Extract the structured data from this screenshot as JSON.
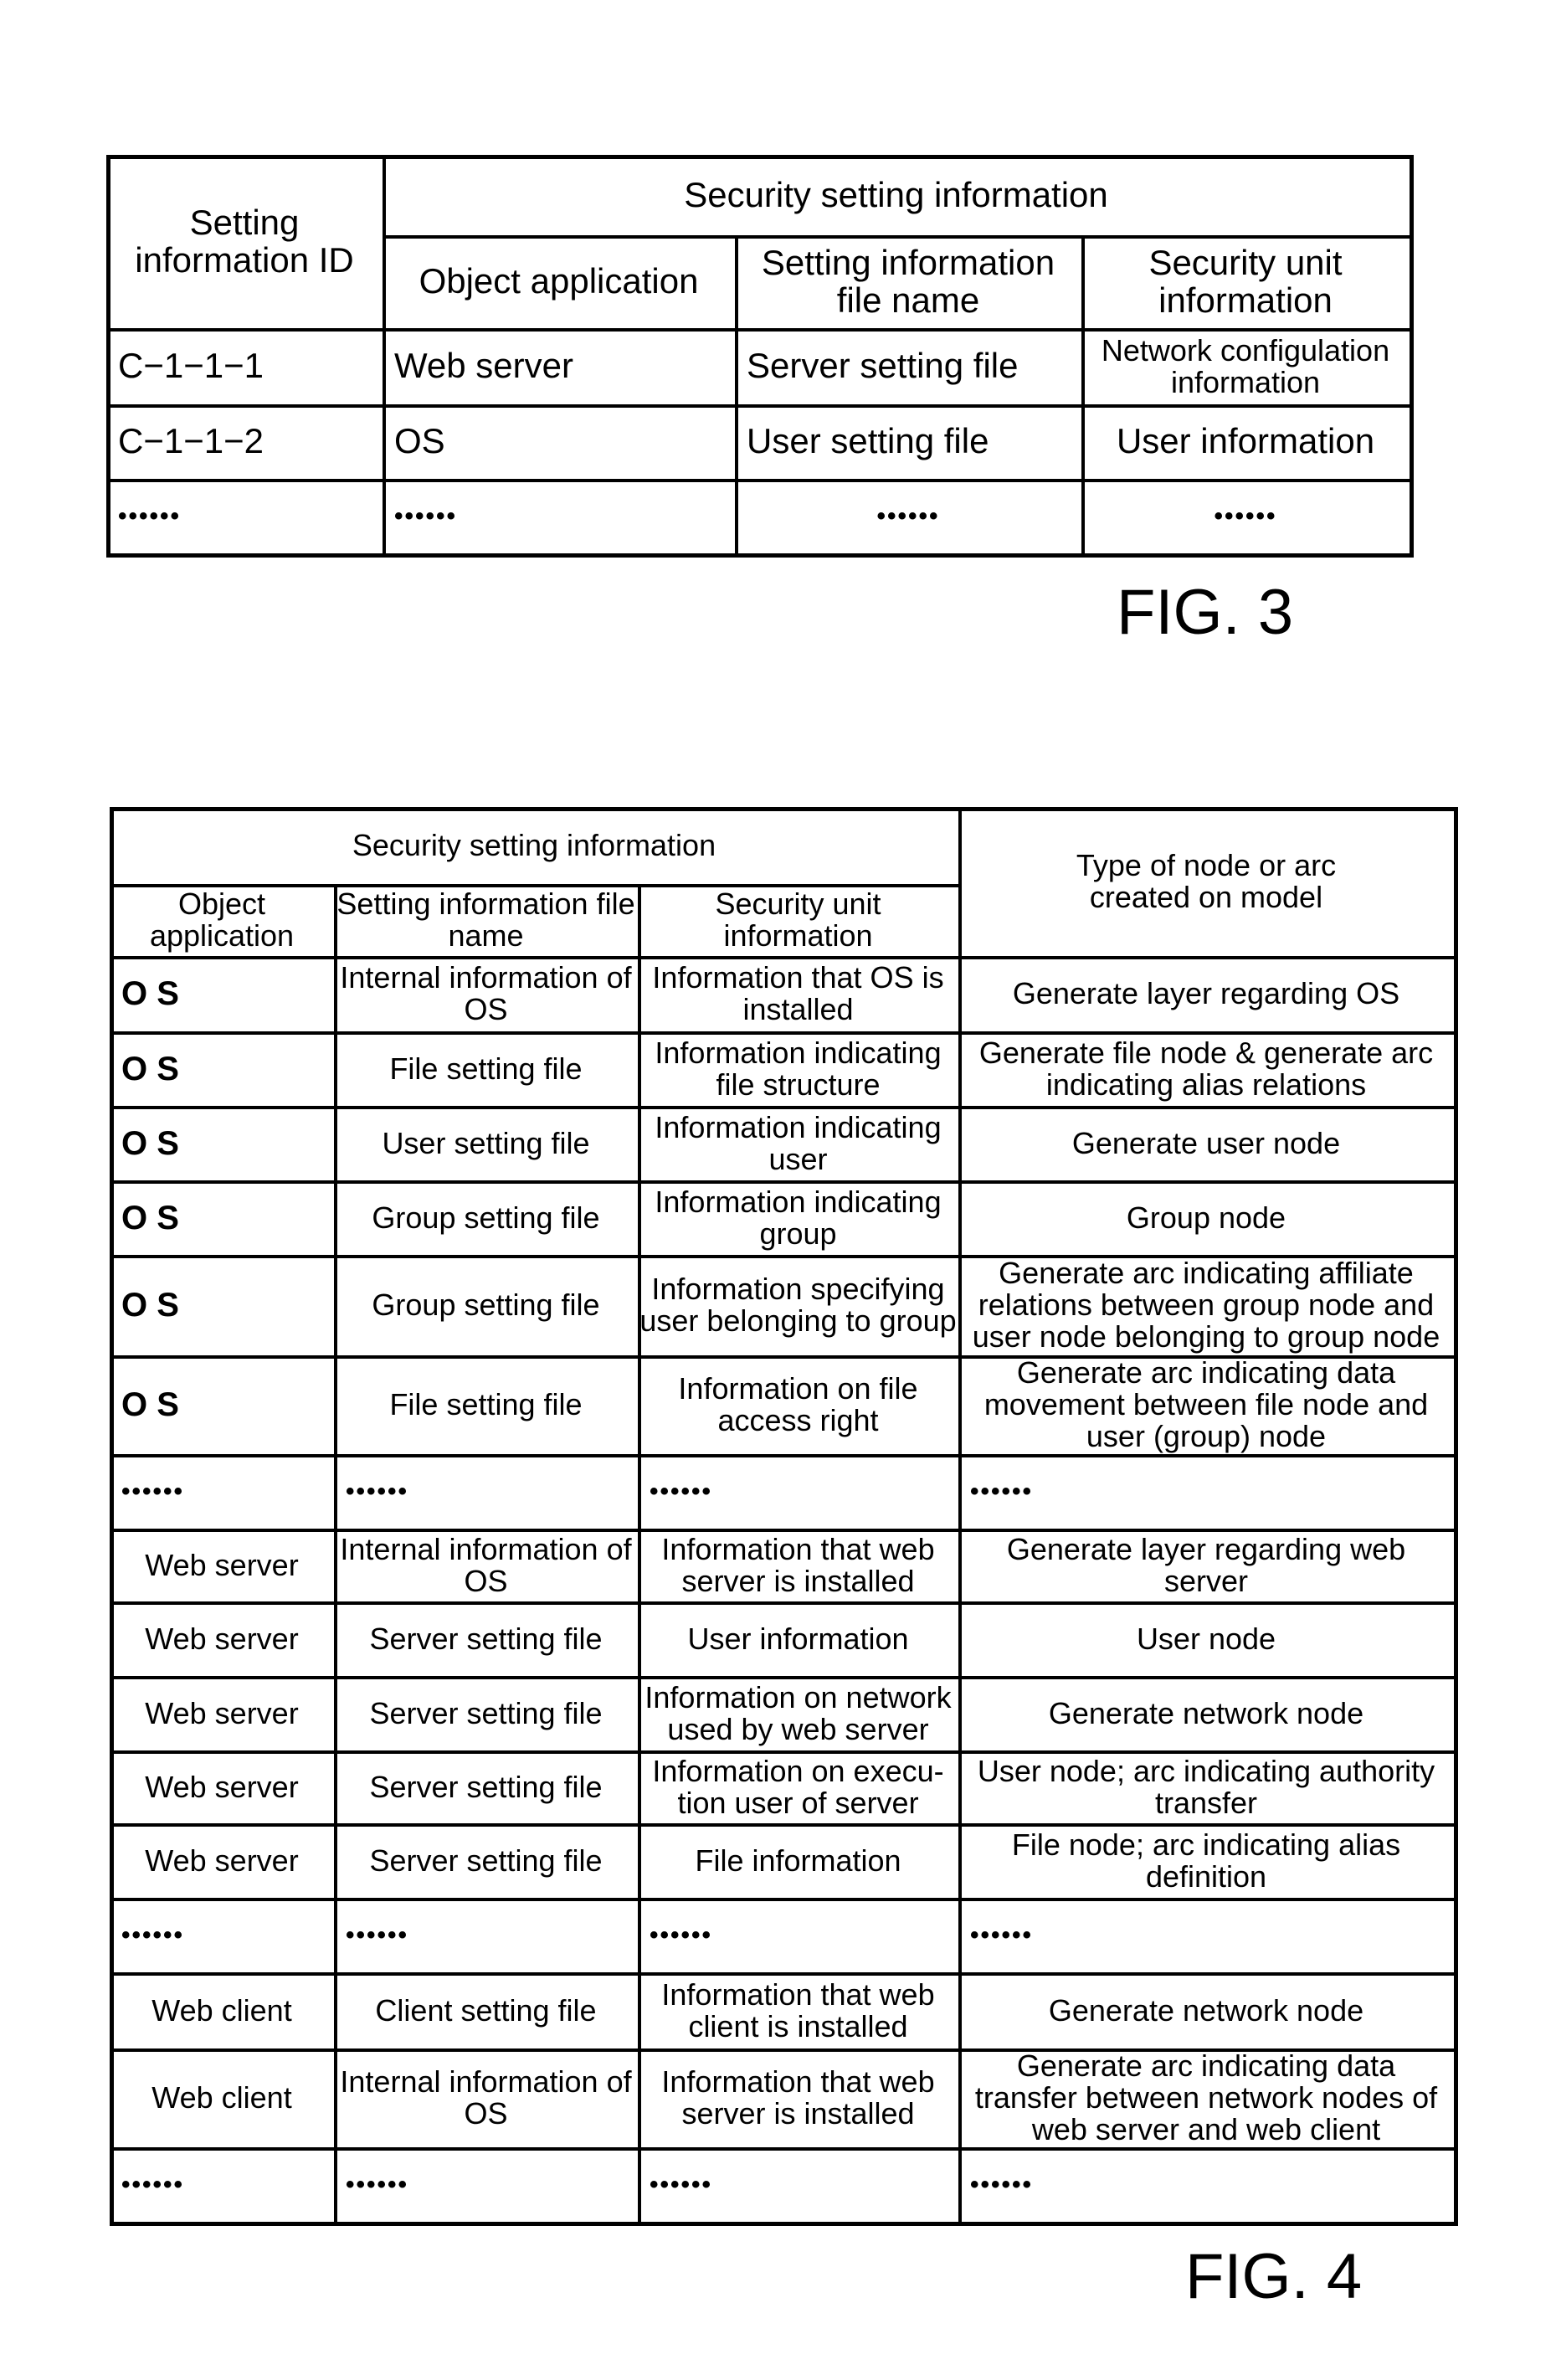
{
  "fig3": {
    "label": "FIG. 3",
    "headers": {
      "id": "Setting information ID",
      "group": "Security setting information",
      "object_application": "Object application",
      "file_name": "Setting information file name",
      "security_unit": "Security unit information"
    },
    "rows": [
      {
        "id": "C−1−1−1",
        "app": "Web server",
        "file": "Server setting file",
        "unit": "Network configulation information"
      },
      {
        "id": "C−1−1−2",
        "app": "OS",
        "file": "User setting file",
        "unit": "User information"
      },
      {
        "id": "••••••",
        "app": "••••••",
        "file": "••••••",
        "unit": "••••••"
      }
    ]
  },
  "fig4": {
    "label": "FIG. 4",
    "headers": {
      "group": "Security setting information",
      "type": "Type of node or arc created on model",
      "object_application": "Object application",
      "file_name": "Setting information file name",
      "security_unit": "Security unit information"
    },
    "rows": [
      {
        "app": "O S",
        "file": "Internal information of OS",
        "unit": "Information that OS is installed",
        "type": "Generate layer regarding OS"
      },
      {
        "app": "O S",
        "file": "File setting file",
        "unit": "Information indicating file structure",
        "type": "Generate file node & generate arc indicating alias relations"
      },
      {
        "app": "O S",
        "file": "User setting file",
        "unit": "Information indicating user",
        "type": "Generate user node"
      },
      {
        "app": "O S",
        "file": "Group setting file",
        "unit": "Information indicating group",
        "type": "Group node"
      },
      {
        "app": "O S",
        "file": "Group setting file",
        "unit": "Information specifying user belonging to group",
        "type": "Generate arc indicating affiliate relations between group node and user node belonging to group node"
      },
      {
        "app": "O S",
        "file": "File setting file",
        "unit": "Information on file access right",
        "type": "Generate arc indicating data movement between file node and user (group) node"
      },
      {
        "app": "••••••",
        "file": "••••••",
        "unit": "••••••",
        "type": "••••••"
      },
      {
        "app": "Web server",
        "file": "Internal information of OS",
        "unit": "Information that web server is installed",
        "type": "Generate layer regarding web server"
      },
      {
        "app": "Web server",
        "file": "Server setting file",
        "unit": "User information",
        "type": "User node"
      },
      {
        "app": "Web server",
        "file": "Server setting file",
        "unit": "Information on network used by web server",
        "type": "Generate network node"
      },
      {
        "app": "Web server",
        "file": "Server setting file",
        "unit": "Information on execu-tion user of server",
        "type": "User node; arc indicating authority transfer"
      },
      {
        "app": "Web server",
        "file": "Server setting file",
        "unit": "File information",
        "type": "File node; arc indicating alias definition"
      },
      {
        "app": "••••••",
        "file": "••••••",
        "unit": "••••••",
        "type": "••••••"
      },
      {
        "app": "Web client",
        "file": "Client setting file",
        "unit": "Information that web client is installed",
        "type": "Generate network node"
      },
      {
        "app": "Web client",
        "file": "Internal information of OS",
        "unit": "Information that web server is installed",
        "type": "Generate arc indicating data transfer between network nodes of web server and web client"
      },
      {
        "app": "••••••",
        "file": "••••••",
        "unit": "••••••",
        "type": "••••••"
      }
    ]
  }
}
